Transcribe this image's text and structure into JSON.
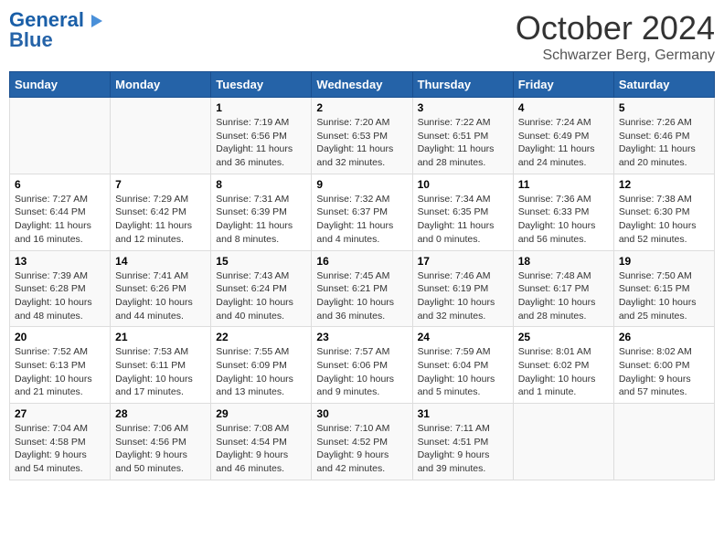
{
  "header": {
    "logo_line1": "General",
    "logo_line2": "Blue",
    "month": "October 2024",
    "location": "Schwarzer Berg, Germany"
  },
  "weekdays": [
    "Sunday",
    "Monday",
    "Tuesday",
    "Wednesday",
    "Thursday",
    "Friday",
    "Saturday"
  ],
  "weeks": [
    [
      {
        "day": "",
        "info": ""
      },
      {
        "day": "",
        "info": ""
      },
      {
        "day": "1",
        "info": "Sunrise: 7:19 AM\nSunset: 6:56 PM\nDaylight: 11 hours\nand 36 minutes."
      },
      {
        "day": "2",
        "info": "Sunrise: 7:20 AM\nSunset: 6:53 PM\nDaylight: 11 hours\nand 32 minutes."
      },
      {
        "day": "3",
        "info": "Sunrise: 7:22 AM\nSunset: 6:51 PM\nDaylight: 11 hours\nand 28 minutes."
      },
      {
        "day": "4",
        "info": "Sunrise: 7:24 AM\nSunset: 6:49 PM\nDaylight: 11 hours\nand 24 minutes."
      },
      {
        "day": "5",
        "info": "Sunrise: 7:26 AM\nSunset: 6:46 PM\nDaylight: 11 hours\nand 20 minutes."
      }
    ],
    [
      {
        "day": "6",
        "info": "Sunrise: 7:27 AM\nSunset: 6:44 PM\nDaylight: 11 hours\nand 16 minutes."
      },
      {
        "day": "7",
        "info": "Sunrise: 7:29 AM\nSunset: 6:42 PM\nDaylight: 11 hours\nand 12 minutes."
      },
      {
        "day": "8",
        "info": "Sunrise: 7:31 AM\nSunset: 6:39 PM\nDaylight: 11 hours\nand 8 minutes."
      },
      {
        "day": "9",
        "info": "Sunrise: 7:32 AM\nSunset: 6:37 PM\nDaylight: 11 hours\nand 4 minutes."
      },
      {
        "day": "10",
        "info": "Sunrise: 7:34 AM\nSunset: 6:35 PM\nDaylight: 11 hours\nand 0 minutes."
      },
      {
        "day": "11",
        "info": "Sunrise: 7:36 AM\nSunset: 6:33 PM\nDaylight: 10 hours\nand 56 minutes."
      },
      {
        "day": "12",
        "info": "Sunrise: 7:38 AM\nSunset: 6:30 PM\nDaylight: 10 hours\nand 52 minutes."
      }
    ],
    [
      {
        "day": "13",
        "info": "Sunrise: 7:39 AM\nSunset: 6:28 PM\nDaylight: 10 hours\nand 48 minutes."
      },
      {
        "day": "14",
        "info": "Sunrise: 7:41 AM\nSunset: 6:26 PM\nDaylight: 10 hours\nand 44 minutes."
      },
      {
        "day": "15",
        "info": "Sunrise: 7:43 AM\nSunset: 6:24 PM\nDaylight: 10 hours\nand 40 minutes."
      },
      {
        "day": "16",
        "info": "Sunrise: 7:45 AM\nSunset: 6:21 PM\nDaylight: 10 hours\nand 36 minutes."
      },
      {
        "day": "17",
        "info": "Sunrise: 7:46 AM\nSunset: 6:19 PM\nDaylight: 10 hours\nand 32 minutes."
      },
      {
        "day": "18",
        "info": "Sunrise: 7:48 AM\nSunset: 6:17 PM\nDaylight: 10 hours\nand 28 minutes."
      },
      {
        "day": "19",
        "info": "Sunrise: 7:50 AM\nSunset: 6:15 PM\nDaylight: 10 hours\nand 25 minutes."
      }
    ],
    [
      {
        "day": "20",
        "info": "Sunrise: 7:52 AM\nSunset: 6:13 PM\nDaylight: 10 hours\nand 21 minutes."
      },
      {
        "day": "21",
        "info": "Sunrise: 7:53 AM\nSunset: 6:11 PM\nDaylight: 10 hours\nand 17 minutes."
      },
      {
        "day": "22",
        "info": "Sunrise: 7:55 AM\nSunset: 6:09 PM\nDaylight: 10 hours\nand 13 minutes."
      },
      {
        "day": "23",
        "info": "Sunrise: 7:57 AM\nSunset: 6:06 PM\nDaylight: 10 hours\nand 9 minutes."
      },
      {
        "day": "24",
        "info": "Sunrise: 7:59 AM\nSunset: 6:04 PM\nDaylight: 10 hours\nand 5 minutes."
      },
      {
        "day": "25",
        "info": "Sunrise: 8:01 AM\nSunset: 6:02 PM\nDaylight: 10 hours\nand 1 minute."
      },
      {
        "day": "26",
        "info": "Sunrise: 8:02 AM\nSunset: 6:00 PM\nDaylight: 9 hours\nand 57 minutes."
      }
    ],
    [
      {
        "day": "27",
        "info": "Sunrise: 7:04 AM\nSunset: 4:58 PM\nDaylight: 9 hours\nand 54 minutes."
      },
      {
        "day": "28",
        "info": "Sunrise: 7:06 AM\nSunset: 4:56 PM\nDaylight: 9 hours\nand 50 minutes."
      },
      {
        "day": "29",
        "info": "Sunrise: 7:08 AM\nSunset: 4:54 PM\nDaylight: 9 hours\nand 46 minutes."
      },
      {
        "day": "30",
        "info": "Sunrise: 7:10 AM\nSunset: 4:52 PM\nDaylight: 9 hours\nand 42 minutes."
      },
      {
        "day": "31",
        "info": "Sunrise: 7:11 AM\nSunset: 4:51 PM\nDaylight: 9 hours\nand 39 minutes."
      },
      {
        "day": "",
        "info": ""
      },
      {
        "day": "",
        "info": ""
      }
    ]
  ]
}
